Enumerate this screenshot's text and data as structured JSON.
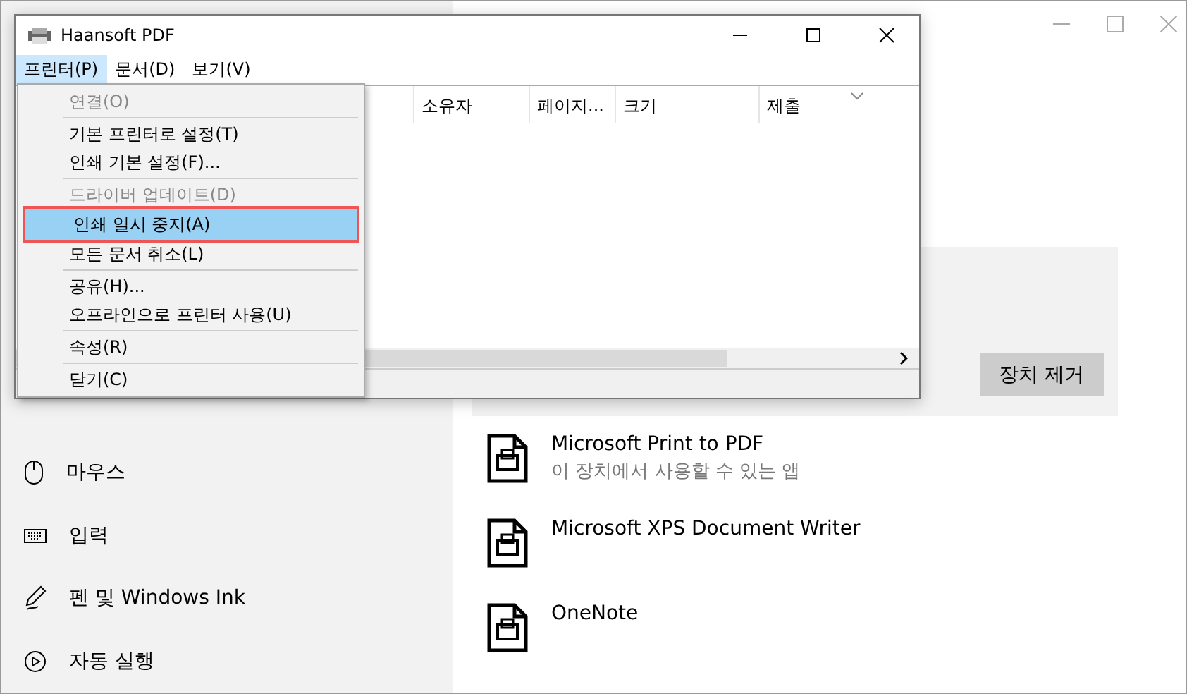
{
  "settings_window": {
    "sidebar": {
      "items": [
        {
          "label": "마우스",
          "kind": "mouse",
          "selected": false
        },
        {
          "label": "입력",
          "kind": "keyboard",
          "selected": false
        },
        {
          "label": "펜 및 Windows Ink",
          "kind": "pen",
          "selected": false
        },
        {
          "label": "자동 실행",
          "kind": "autoplay",
          "selected": false
        }
      ]
    },
    "buttons": [
      "장치 제거"
    ],
    "printers": [
      {
        "name": "Microsoft Print to PDF",
        "subtitle": "이 장치에서 사용할 수 있는 앱"
      },
      {
        "name": "Microsoft XPS Document Writer"
      },
      {
        "name": "OneNote"
      }
    ]
  },
  "queue_window": {
    "title": "Haansoft PDF",
    "menu_bar": [
      {
        "label": "프린터(P)",
        "selected": true
      },
      {
        "label": "문서(D)",
        "selected": false
      },
      {
        "label": "보기(V)",
        "selected": false
      }
    ],
    "columns": [
      "소유자",
      "페이지...",
      "크기",
      "제출"
    ]
  },
  "menu": {
    "groups": [
      [
        {
          "label": "연결(O)",
          "disabled": true,
          "selected": false
        }
      ],
      [
        {
          "label": "기본 프린터로 설정(T)",
          "disabled": false,
          "selected": false
        },
        {
          "label": "인쇄 기본 설정(F)...",
          "disabled": false,
          "selected": false
        }
      ],
      [
        {
          "label": "드라이버 업데이트(D)",
          "disabled": true,
          "selected": false
        },
        {
          "label": "인쇄 일시 중지(A)",
          "disabled": false,
          "selected": true
        },
        {
          "label": "모든 문서 취소(L)",
          "disabled": false,
          "selected": false
        }
      ],
      [
        {
          "label": "공유(H)...",
          "disabled": false,
          "selected": false
        },
        {
          "label": "오프라인으로 프린터 사용(U)",
          "disabled": false,
          "selected": false
        }
      ],
      [
        {
          "label": "속성(R)",
          "disabled": false,
          "selected": false
        }
      ],
      [
        {
          "label": "닫기(C)",
          "disabled": false,
          "selected": false
        }
      ]
    ]
  }
}
